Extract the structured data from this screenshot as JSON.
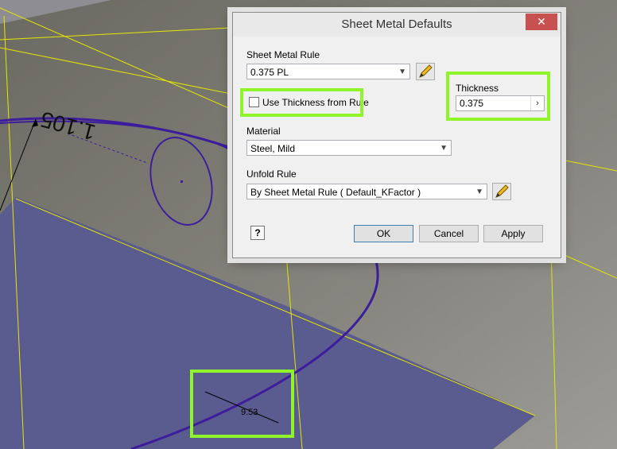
{
  "scene": {
    "dimension_1": "1.105",
    "dimension_2": "9.53",
    "colors": {
      "background": "#5f5e5a",
      "face": "#5a5b8f",
      "edge": "#3d1d9c",
      "construction": "#e7e600",
      "highlight": "#8ff52a"
    }
  },
  "dialog": {
    "title": "Sheet Metal Defaults",
    "close_icon": "close-x-icon",
    "sheet_metal_rule": {
      "label": "Sheet Metal Rule",
      "value": "0.375 PL"
    },
    "use_thickness_from_rule": {
      "label": "Use Thickness from Rule",
      "checked": false
    },
    "thickness": {
      "label": "Thickness",
      "value": "0.375"
    },
    "material": {
      "label": "Material",
      "value": "Steel, Mild"
    },
    "unfold_rule": {
      "label": "Unfold Rule",
      "value": "By Sheet Metal Rule ( Default_KFactor )"
    },
    "buttons": {
      "ok": "OK",
      "cancel": "Cancel",
      "apply": "Apply",
      "help_icon": "help-icon"
    }
  }
}
